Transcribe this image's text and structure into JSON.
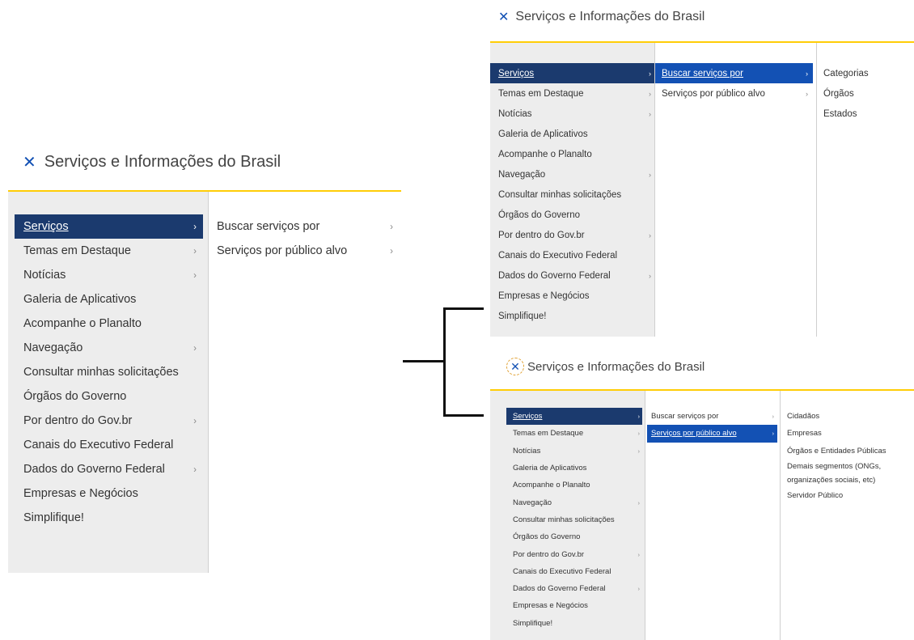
{
  "panel_title": "Serviços e Informações do Brasil",
  "main_menu": [
    {
      "label": "Serviços",
      "has_submenu": true
    },
    {
      "label": "Temas em Destaque",
      "has_submenu": true
    },
    {
      "label": "Notícias",
      "has_submenu": true
    },
    {
      "label": "Galeria de Aplicativos",
      "has_submenu": false
    },
    {
      "label": "Acompanhe o Planalto",
      "has_submenu": false
    },
    {
      "label": "Navegação",
      "has_submenu": true
    },
    {
      "label": "Consultar minhas solicitações",
      "has_submenu": false
    },
    {
      "label": "Órgãos do Governo",
      "has_submenu": false
    },
    {
      "label": "Por dentro do Gov.br",
      "has_submenu": true
    },
    {
      "label": "Canais do Executivo Federal",
      "has_submenu": false
    },
    {
      "label": "Dados do Governo Federal",
      "has_submenu": true
    },
    {
      "label": "Empresas e Negócios",
      "has_submenu": false
    },
    {
      "label": "Simplifique!",
      "has_submenu": false
    }
  ],
  "servicos_submenu": [
    "Buscar serviços por",
    "Serviços por público alvo"
  ],
  "buscar_servicos_submenu": [
    "Categorias",
    "Órgãos",
    "Estados"
  ],
  "publico_alvo_submenu": [
    "Cidadãos",
    "Empresas",
    "Órgãos e Entidades Públicas",
    "Demais segmentos (ONGs, organizações sociais, etc)",
    "Servidor Público"
  ],
  "chevron_glyph": "›",
  "close_glyph": "✕",
  "colors": {
    "active_item_bg": "#1b3a6e",
    "highlight_item_bg": "#1351b4",
    "close_icon": "#1351b4",
    "accent_line": "#ffcd07",
    "sidebar_bg": "#ededed"
  }
}
